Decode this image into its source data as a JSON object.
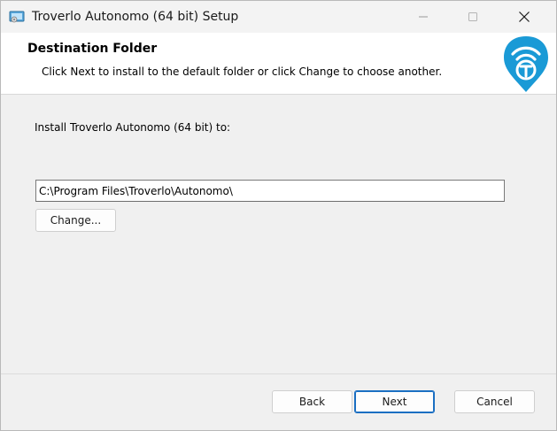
{
  "window": {
    "title": "Troverlo Autonomo (64 bit) Setup"
  },
  "banner": {
    "title": "Destination Folder",
    "subtitle": "Click Next to install to the default folder or click Change to choose another.",
    "logo_color": "#1a9ad6"
  },
  "main": {
    "install_label": "Install Troverlo Autonomo (64 bit) to:",
    "install_path": "C:\\Program Files\\Troverlo\\Autonomo\\",
    "change_label": "Change..."
  },
  "footer": {
    "back_label": "Back",
    "next_label": "Next",
    "cancel_label": "Cancel"
  },
  "icons": {
    "app": "installer-icon",
    "minimize": "minimize-icon",
    "maximize": "maximize-icon",
    "close": "close-icon",
    "logo": "wifi-pin-logo"
  }
}
